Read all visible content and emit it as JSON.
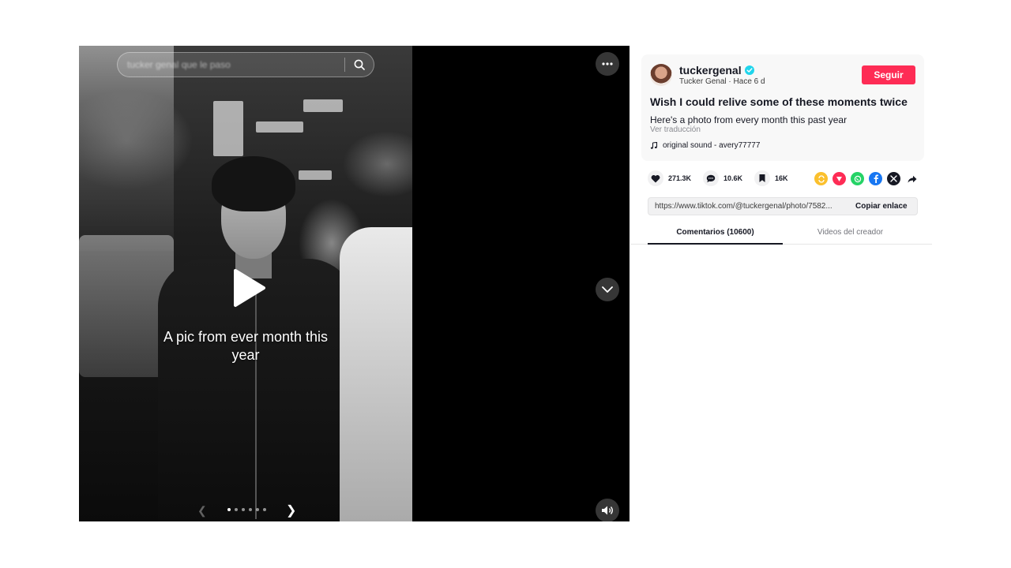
{
  "player": {
    "search_placeholder": "tucker genal que le paso",
    "caption": "A pic from ever month this year",
    "carousel": {
      "count": 6,
      "active_index": 0
    }
  },
  "author": {
    "username": "tuckergenal",
    "subline": "Tucker Genal · Hace 6 d",
    "follow_label": "Seguir"
  },
  "post": {
    "title": "Wish I could relive some of these moments twice",
    "description": "Here's a photo from every month this past year",
    "translate_label": "Ver traducción",
    "sound": "original sound - avery77777"
  },
  "stats": {
    "likes": "271.3K",
    "comments": "10.6K",
    "saves": "16K"
  },
  "share": {
    "link": "https://www.tiktok.com/@tuckergenal/photo/7582...",
    "copy_label": "Copiar enlace",
    "icons": [
      "repost-icon",
      "tiktok-share-icon",
      "whatsapp-icon",
      "facebook-icon",
      "x-icon",
      "forward-icon"
    ]
  },
  "tabs": {
    "comments": "Comentarios (10600)",
    "videos": "Videos del creador"
  },
  "colors": {
    "accent": "#fe2c55",
    "verified": "#20d5ec",
    "whatsapp": "#25d366",
    "facebook": "#1877f2"
  }
}
